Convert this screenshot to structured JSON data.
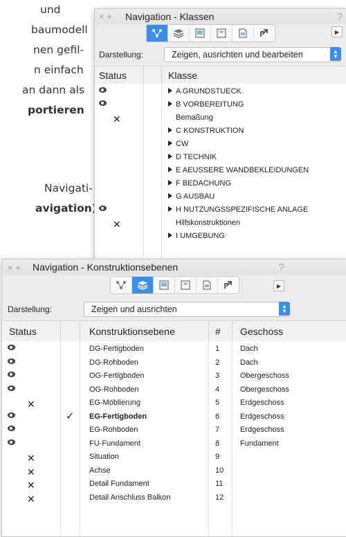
{
  "background": {
    "lines": [
      "und",
      "baumodell",
      "nen gefil-",
      "n einfach",
      "an dann als",
      "portieren"
    ],
    "lines2": [
      "Navigati-",
      "avigation)"
    ]
  },
  "panel1": {
    "title": "Navigation - Klassen",
    "help": "?",
    "controls": "× +",
    "display_label": "Darstellung:",
    "display_value": "Zeigen, ausrichten und bearbeiten",
    "col_status": "Status",
    "col_klasse": "Klasse",
    "rows": [
      {
        "eye": true,
        "x": false,
        "tri": true,
        "name": "A GRUNDSTUECK"
      },
      {
        "eye": true,
        "x": false,
        "tri": true,
        "name": "B VORBEREITUNG"
      },
      {
        "eye": false,
        "x": true,
        "tri": false,
        "name": "Bemaßung"
      },
      {
        "eye": false,
        "x": false,
        "tri": true,
        "name": "C KONSTRUKTION"
      },
      {
        "eye": false,
        "x": false,
        "tri": true,
        "name": "CW"
      },
      {
        "eye": false,
        "x": false,
        "tri": true,
        "name": "D TECHNIK"
      },
      {
        "eye": false,
        "x": false,
        "tri": true,
        "name": "E AEUSSERE WANDBEKLEIDUNGEN"
      },
      {
        "eye": false,
        "x": false,
        "tri": true,
        "name": "F BEDACHUNG"
      },
      {
        "eye": false,
        "x": false,
        "tri": true,
        "name": "G AUSBAU"
      },
      {
        "eye": true,
        "x": false,
        "tri": true,
        "name": "H NUTZUNGSSPEZIFISCHE ANLAGE"
      },
      {
        "eye": false,
        "x": true,
        "tri": false,
        "name": "Hilfskonstruktionen"
      },
      {
        "eye": false,
        "x": false,
        "tri": true,
        "name": "I UMGEBUNG"
      }
    ]
  },
  "panel2": {
    "title": "Navigation - Konstruktionsebenen",
    "help": "?",
    "controls": "× +",
    "display_label": "Darstellung:",
    "display_value": "Zeigen und ausrichten",
    "col_status": "Status",
    "col_ebene": "Konstruktionsebene",
    "col_num": "#",
    "col_geschoss": "Geschoss",
    "rows": [
      {
        "eye": true,
        "x": false,
        "check": false,
        "bold": false,
        "ebene": "DG-Fertigboden",
        "num": "1",
        "geschoss": "Dach"
      },
      {
        "eye": true,
        "x": false,
        "check": false,
        "bold": false,
        "ebene": "DG-Rohboden",
        "num": "2",
        "geschoss": "Dach"
      },
      {
        "eye": true,
        "x": false,
        "check": false,
        "bold": false,
        "ebene": "OG-Fertigboden",
        "num": "3",
        "geschoss": "Obergeschoss"
      },
      {
        "eye": true,
        "x": false,
        "check": false,
        "bold": false,
        "ebene": "OG-Rohboden",
        "num": "4",
        "geschoss": "Obergeschoss"
      },
      {
        "eye": false,
        "x": true,
        "check": false,
        "bold": false,
        "ebene": "EG-Möblierung",
        "num": "5",
        "geschoss": "Erdgeschoss"
      },
      {
        "eye": true,
        "x": false,
        "check": true,
        "bold": true,
        "ebene": "EG-Fertigboden",
        "num": "6",
        "geschoss": "Erdgeschoss"
      },
      {
        "eye": true,
        "x": false,
        "check": false,
        "bold": false,
        "ebene": "EG-Rohboden",
        "num": "7",
        "geschoss": "Erdgeschoss"
      },
      {
        "eye": true,
        "x": false,
        "check": false,
        "bold": false,
        "ebene": "FU-Fundament",
        "num": "8",
        "geschoss": "Fundament"
      },
      {
        "eye": false,
        "x": true,
        "check": false,
        "bold": false,
        "ebene": "Situation",
        "num": "9",
        "geschoss": ""
      },
      {
        "eye": false,
        "x": true,
        "check": false,
        "bold": false,
        "ebene": "Achse",
        "num": "10",
        "geschoss": ""
      },
      {
        "eye": false,
        "x": true,
        "check": false,
        "bold": false,
        "ebene": "Detail Fundament",
        "num": "11",
        "geschoss": ""
      },
      {
        "eye": false,
        "x": true,
        "check": false,
        "bold": false,
        "ebene": "Detail Anschluss Balkon",
        "num": "12",
        "geschoss": ""
      }
    ]
  },
  "colors": {
    "accent": "#3a8ee6"
  },
  "toolbar_icons": [
    "network-icon",
    "layers-icon",
    "sheet-icon",
    "viewport-icon",
    "document-icon",
    "export-icon"
  ]
}
